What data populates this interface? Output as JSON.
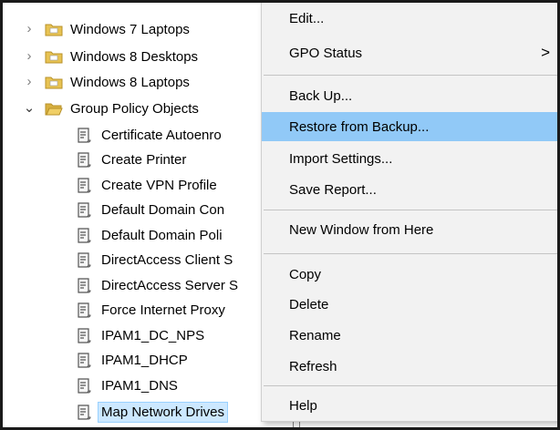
{
  "tree": {
    "items": [
      {
        "label": "Windows 7 Laptops",
        "type": "folder",
        "expander": "›"
      },
      {
        "label": "Windows 8 Desktops",
        "type": "folder",
        "expander": "›"
      },
      {
        "label": "Windows 8 Laptops",
        "type": "folder",
        "expander": "›"
      },
      {
        "label": "Group Policy Objects",
        "type": "folder",
        "expander": "⌄"
      },
      {
        "label": "Certificate Autoenro",
        "type": "gpo"
      },
      {
        "label": "Create Printer",
        "type": "gpo"
      },
      {
        "label": "Create VPN Profile",
        "type": "gpo"
      },
      {
        "label": "Default Domain Con",
        "type": "gpo"
      },
      {
        "label": "Default Domain Poli",
        "type": "gpo"
      },
      {
        "label": "DirectAccess Client S",
        "type": "gpo"
      },
      {
        "label": "DirectAccess Server S",
        "type": "gpo"
      },
      {
        "label": "Force Internet Proxy",
        "type": "gpo"
      },
      {
        "label": "IPAM1_DC_NPS",
        "type": "gpo"
      },
      {
        "label": "IPAM1_DHCP",
        "type": "gpo"
      },
      {
        "label": "IPAM1_DNS",
        "type": "gpo"
      },
      {
        "label": "Map Network Drives",
        "type": "gpo",
        "selected": true
      }
    ]
  },
  "context_menu": {
    "items": [
      {
        "label": "Edit..."
      },
      {
        "label": "GPO Status",
        "submenu_arrow": ">"
      },
      {
        "label": "Back Up..."
      },
      {
        "label": "Restore from Backup...",
        "highlighted": true
      },
      {
        "label": "Import Settings..."
      },
      {
        "label": "Save Report..."
      },
      {
        "label": "New Window from Here"
      },
      {
        "label": "Copy"
      },
      {
        "label": "Delete"
      },
      {
        "label": "Rename"
      },
      {
        "label": "Refresh"
      },
      {
        "label": "Help"
      }
    ]
  },
  "colors": {
    "menu_background": "#f2f2f2",
    "menu_highlight": "#91c9f7",
    "folder_yellow": "#e8c352",
    "selection": "#cce8ff"
  }
}
